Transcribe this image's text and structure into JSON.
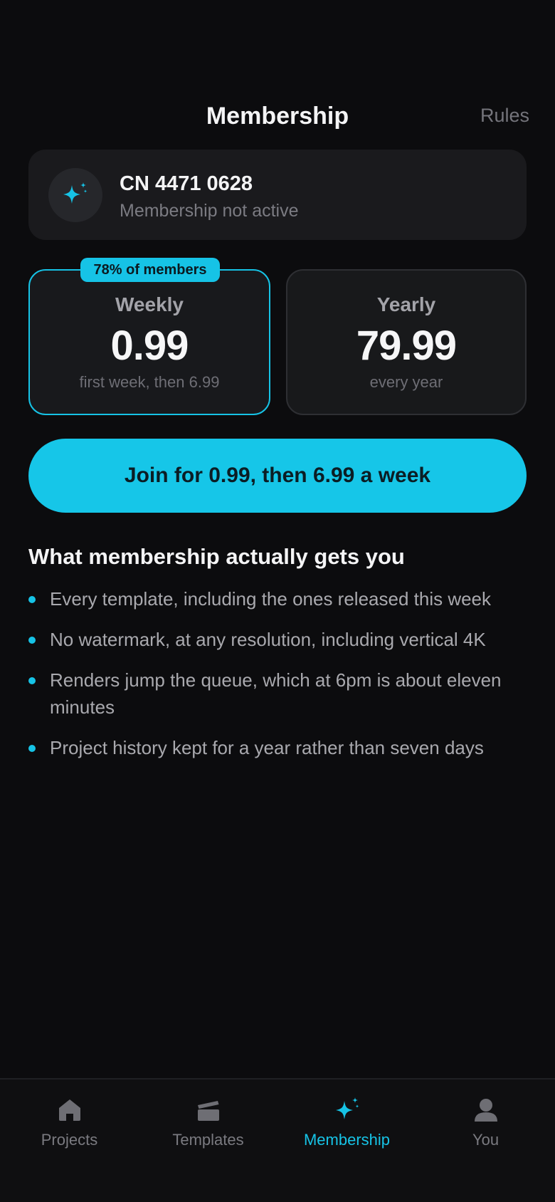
{
  "header": {
    "title": "Membership",
    "rules_label": "Rules"
  },
  "account": {
    "id": "CN 4471 0628",
    "status": "Membership not active",
    "icon": "sparkle-icon"
  },
  "plans": [
    {
      "name": "Weekly",
      "price": "0.99",
      "note": "first week, then 6.99",
      "badge": "78% of members",
      "selected": true
    },
    {
      "name": "Yearly",
      "price": "79.99",
      "note": "every year",
      "selected": false
    }
  ],
  "cta": {
    "label": "Join for 0.99, then 6.99 a week"
  },
  "benefits": {
    "title": "What membership actually gets you",
    "items": [
      "Every template, including the ones released this week",
      "No watermark, at any resolution, including vertical 4K",
      "Renders jump the queue, which at 6pm is about eleven minutes",
      "Project history kept for a year rather than seven days"
    ]
  },
  "tabbar": {
    "items": [
      {
        "label": "Projects",
        "icon": "home-icon",
        "active": false
      },
      {
        "label": "Templates",
        "icon": "clapperboard-icon",
        "active": false
      },
      {
        "label": "Membership",
        "icon": "sparkle-icon",
        "active": true
      },
      {
        "label": "You",
        "icon": "user-icon",
        "active": false
      }
    ]
  },
  "colors": {
    "accent": "#16c3e6",
    "background": "#0c0c0e",
    "card": "#1a1a1d"
  }
}
